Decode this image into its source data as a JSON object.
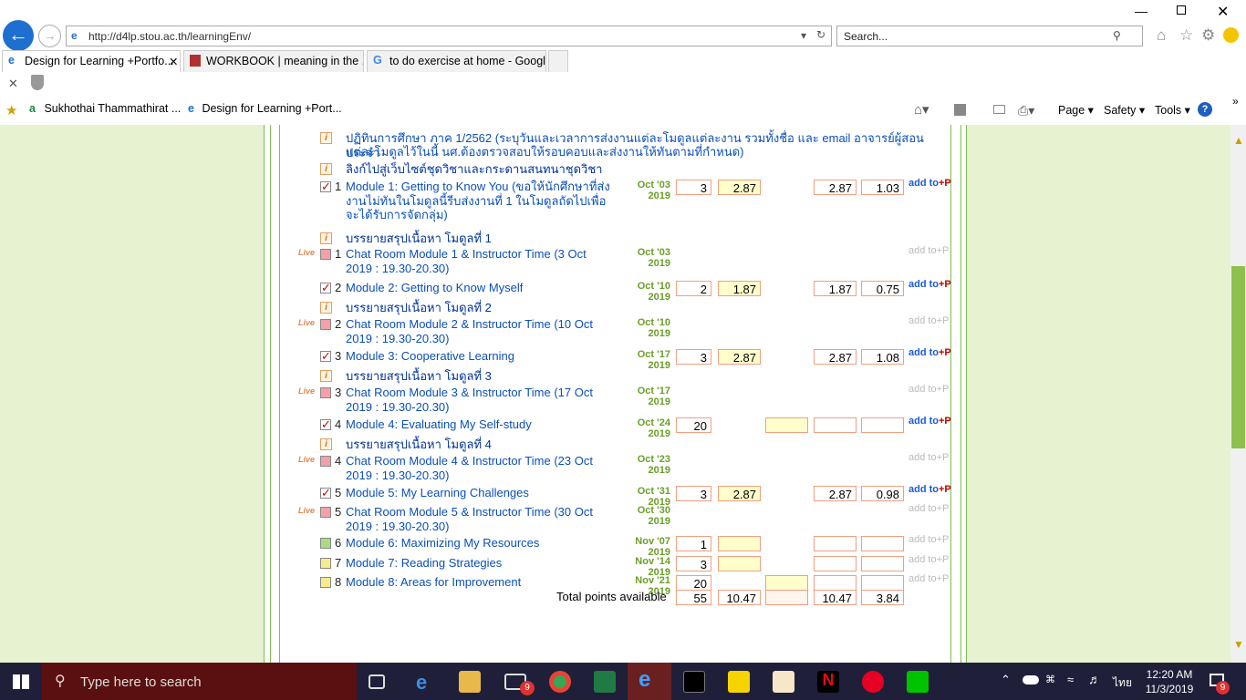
{
  "browser": {
    "url": "http://d4lp.stou.ac.th/learningEnv/",
    "search_placeholder": "Search...",
    "tabs": [
      {
        "label": "Design for Learning +Portfo..."
      },
      {
        "label": "WORKBOOK | meaning in the ..."
      },
      {
        "label": "to do exercise at home - Googl..."
      }
    ],
    "favorites": [
      {
        "label": "Sukhothai Thammathirat ..."
      },
      {
        "label": "Design for Learning +Port..."
      }
    ],
    "commands": {
      "page": "Page",
      "safety": "Safety",
      "tools": "Tools"
    }
  },
  "content": {
    "intro_line1": "ปฏิทินการศึกษา ภาค 1/2562 (ระบุวันและเวลาการส่งงานแต่ละโมดูลแต่ละงาน รวมทั้งชื่อ และ email อาจารย์ผู้สอนประจำ",
    "intro_line2": "แต่ละโมดูลไว้ในนี้ นศ.ต้องตรวจสอบให้รอบคอบและส่งงานให้ทันตามที่กำหนด)",
    "link_line": "ลิงก์ไปสู่เว็บไซต์ชุดวิชาและกระดานสนทนาชุดวิชา",
    "live_label": "Live",
    "info_glyph": "i",
    "add_label": "add to",
    "plus_p": "+P",
    "rows": [
      {
        "num": "1",
        "title": "Module 1: Getting to Know You (ขอให้นักศึกษาที่ส่งงานไม่ทันในโมดูลนี้รีบส่งงานที่ 1 ในโมดูลถัดไปเพื่อจะได้รับการจัดกลุ่ม)",
        "date": "Oct '03 2019",
        "v1": "3",
        "v2": "2.87",
        "v3": "",
        "v4": "2.87",
        "v5": "1.03"
      },
      {
        "summary": "บรรยายสรุปเนื้อหา โมดูลที่ 1"
      },
      {
        "num": "1",
        "title": "Chat Room Module 1 & Instructor Time (3 Oct 2019 : 19.30-20.30)",
        "date": "Oct '03 2019"
      },
      {
        "num": "2",
        "title": "Module 2: Getting to Know Myself",
        "date": "Oct '10 2019",
        "v1": "2",
        "v2": "1.87",
        "v4": "1.87",
        "v5": "0.75"
      },
      {
        "summary": "บรรยายสรุปเนื้อหา โมดูลที่ 2"
      },
      {
        "num": "2",
        "title": "Chat Room Module 2 & Instructor Time (10 Oct 2019 : 19.30-20.30)",
        "date": "Oct '10 2019"
      },
      {
        "num": "3",
        "title": "Module 3: Cooperative Learning",
        "date": "Oct '17 2019",
        "v1": "3",
        "v2": "2.87",
        "v4": "2.87",
        "v5": "1.08"
      },
      {
        "summary": "บรรยายสรุปเนื้อหา โมดูลที่ 3"
      },
      {
        "num": "3",
        "title": "Chat Room Module 3 & Instructor Time (17 Oct 2019 : 19.30-20.30)",
        "date": "Oct '17 2019"
      },
      {
        "num": "4",
        "title": "Module 4: Evaluating My Self-study",
        "date": "Oct '24 2019",
        "v1": "20"
      },
      {
        "summary": "บรรยายสรุปเนื้อหา โมดูลที่ 4"
      },
      {
        "num": "4",
        "title": "Chat Room Module 4 & Instructor Time (23 Oct 2019 : 19.30-20.30)",
        "date": "Oct '23 2019"
      },
      {
        "num": "5",
        "title": "Module 5: My Learning Challenges",
        "date": "Oct '31 2019",
        "v1": "3",
        "v2": "2.87",
        "v4": "2.87",
        "v5": "0.98"
      },
      {
        "num": "5",
        "title": "Chat Room Module 5 & Instructor Time (30 Oct 2019 : 19.30-20.30)",
        "date": "Oct '30 2019"
      },
      {
        "num": "6",
        "title": "Module 6: Maximizing My Resources",
        "date": "Nov '07 2019",
        "v1": "1"
      },
      {
        "num": "7",
        "title": "Module 7: Reading Strategies",
        "date": "Nov '14 2019",
        "v1": "3"
      },
      {
        "num": "8",
        "title": "Module 8: Areas for Improvement",
        "date": "Nov '21 2019",
        "v1": "20"
      }
    ],
    "total": {
      "label": "Total points available",
      "v1": "55",
      "v2": "10.47",
      "v4": "10.47",
      "v5": "3.84"
    }
  },
  "taskbar": {
    "search_placeholder": "Type here to search",
    "time": "12:20 AM",
    "date": "11/3/2019",
    "lang": "ไทย",
    "mail_badge": "9",
    "notif_badge": "9"
  }
}
